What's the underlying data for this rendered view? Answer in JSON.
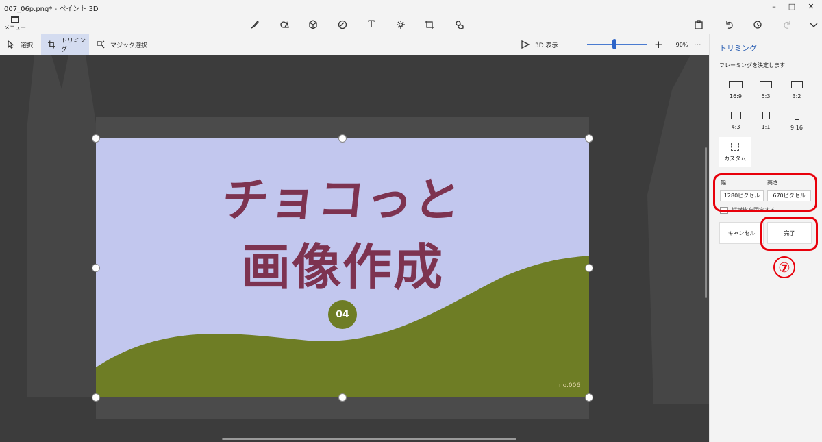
{
  "window": {
    "title": "007_06p.png* - ペイント 3D",
    "menu_label": "メニュー",
    "controls": {
      "minimize": "–",
      "maximize": "□",
      "close": "✕"
    }
  },
  "top_tools": [
    {
      "name": "brushes-icon"
    },
    {
      "name": "2d-shapes-icon"
    },
    {
      "name": "3d-shapes-icon"
    },
    {
      "name": "stickers-icon"
    },
    {
      "name": "text-icon",
      "glyph": "T"
    },
    {
      "name": "effects-icon"
    },
    {
      "name": "canvas-icon"
    },
    {
      "name": "3d-library-icon"
    }
  ],
  "right_tools": [
    "paste-icon",
    "undo-icon",
    "history-icon",
    "redo-icon",
    "expand-icon"
  ],
  "toolbar": {
    "select_label": "選択",
    "crop_label": "トリミング",
    "magic_label": "マジック選択",
    "view3d_label": "3D 表示",
    "zoom_out": "—",
    "zoom_in": "+",
    "zoom_level": "90%",
    "zoom_value": 0.45,
    "more": "···"
  },
  "image": {
    "title_line1": "チョコっと",
    "title_line2": "画像作成",
    "badge": "04",
    "code": "no.006",
    "background_color": "#c2c7ee",
    "hill_color": "#6e7d25",
    "title_color": "#7d3350"
  },
  "panel": {
    "title": "トリミング",
    "subtitle": "フレーミングを決定します",
    "ratios": [
      "16:9",
      "5:3",
      "3:2",
      "4:3",
      "1:1",
      "9:16"
    ],
    "custom_label": "カスタム",
    "width_label": "幅",
    "height_label": "高さ",
    "width_value": "1280ピクセル",
    "height_value": "670ピクセル",
    "lock_label": "縦横比を固定する",
    "cancel_label": "キャンセル",
    "done_label": "完了"
  },
  "annotation": {
    "step": "⑦",
    "color": "#e8000b"
  }
}
